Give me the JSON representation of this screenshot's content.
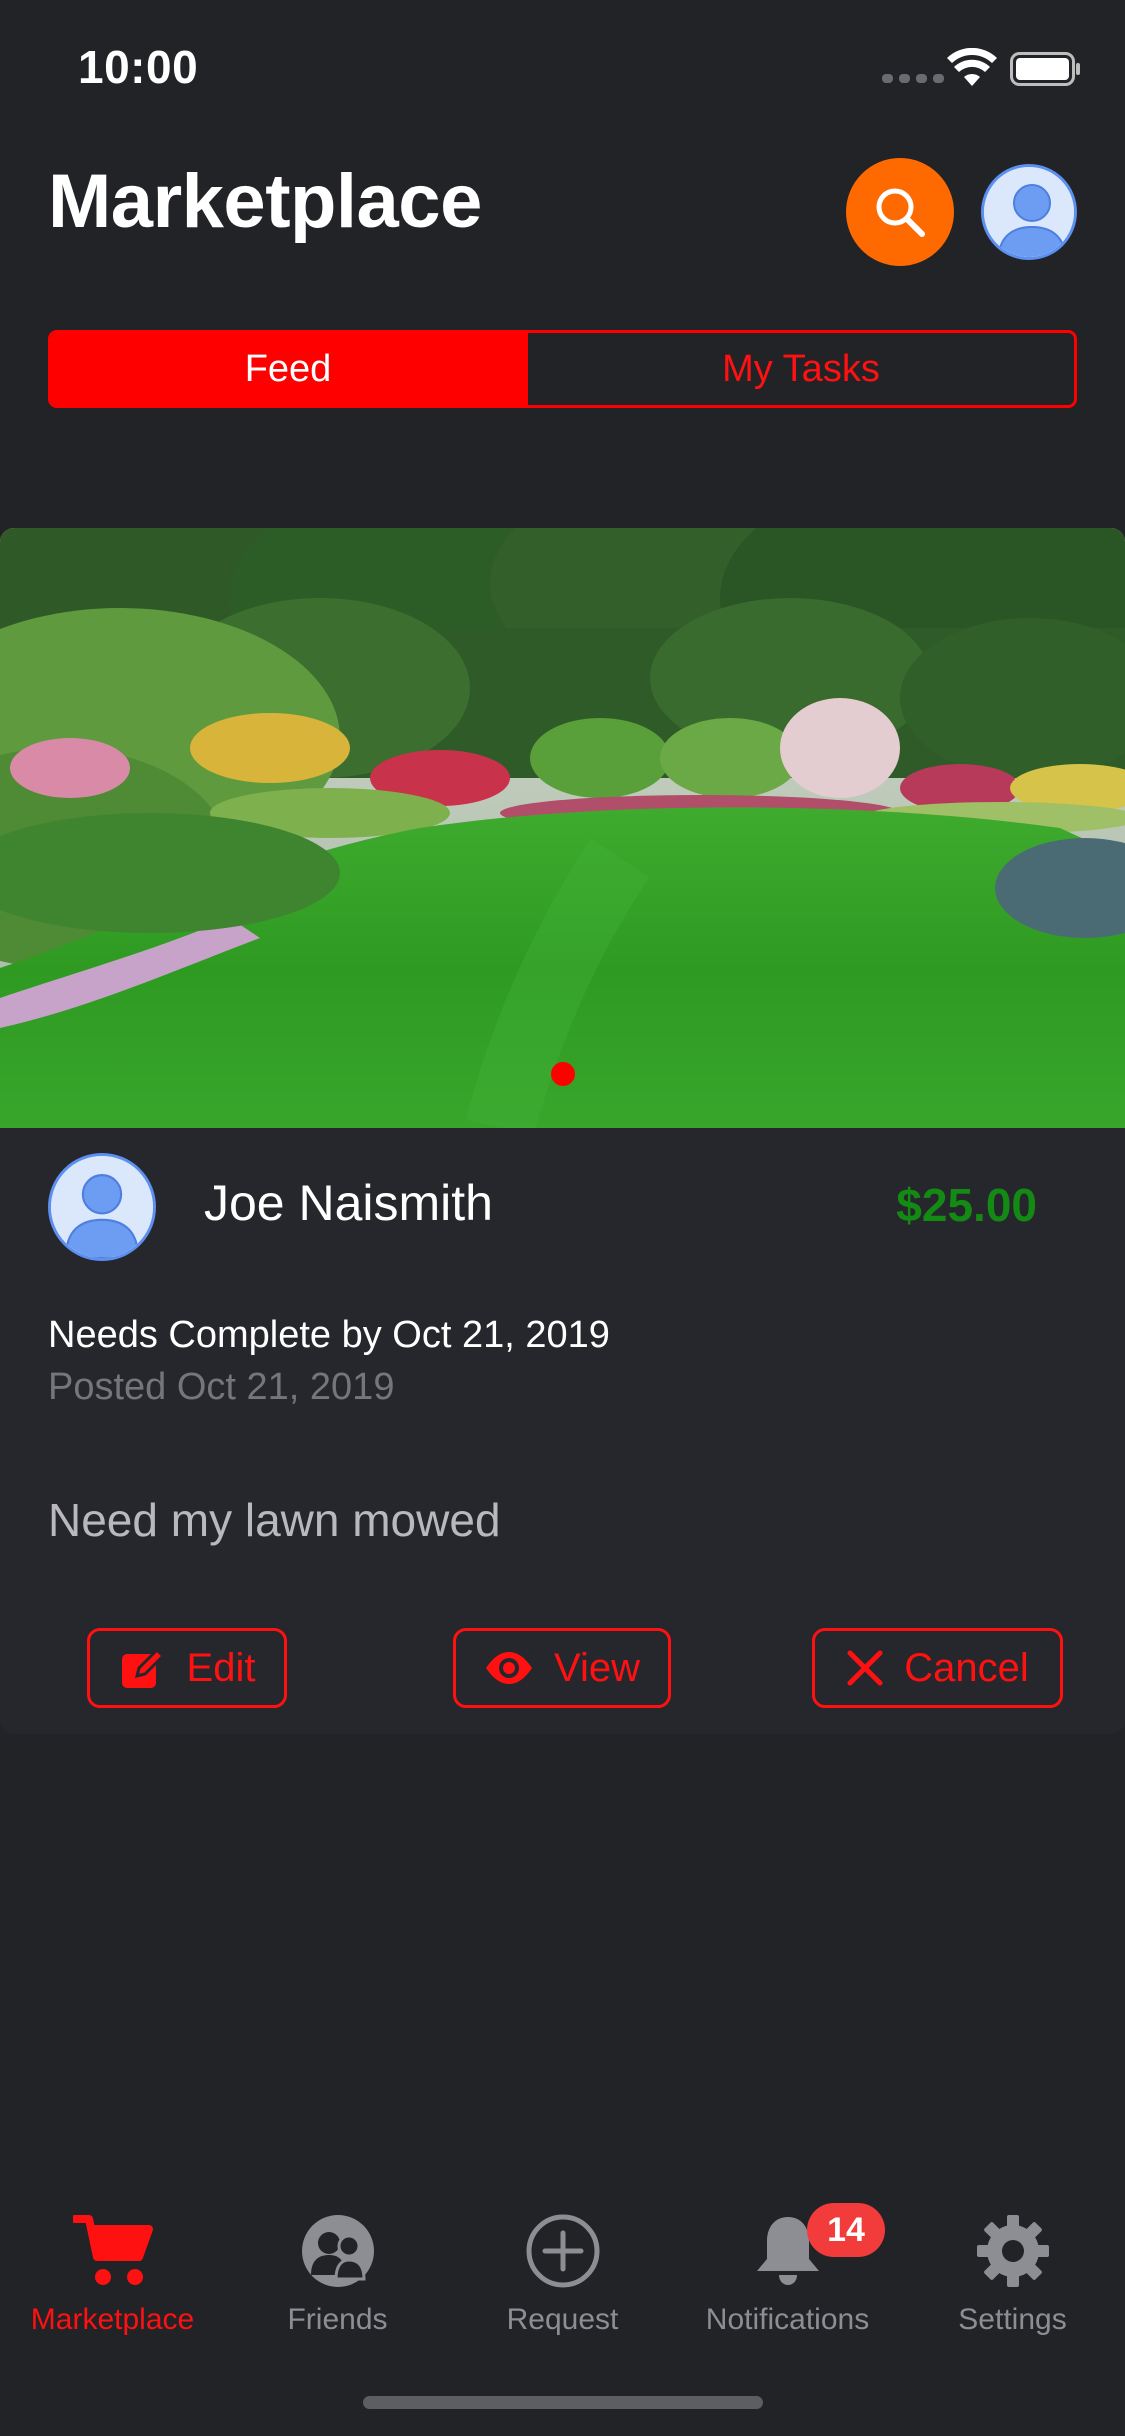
{
  "status_bar": {
    "time": "10:00"
  },
  "header": {
    "title": "Marketplace",
    "search_icon": "search-icon",
    "avatar_icon": "person-icon"
  },
  "segmented_control": {
    "selected": "Feed",
    "feed_label": "Feed",
    "my_tasks_label": "My Tasks"
  },
  "task_card": {
    "image": "lawn-garden-photo",
    "carousel": {
      "current_page": 1,
      "total_pages": 1
    },
    "poster_name": "Joe Naismith",
    "price": "$25.00",
    "deadline": "Needs Complete by Oct 21, 2019",
    "posted": "Posted Oct 21, 2019",
    "description": "Need my lawn mowed",
    "actions": {
      "edit_label": "Edit",
      "view_label": "View",
      "cancel_label": "Cancel"
    }
  },
  "tab_bar": {
    "items": [
      {
        "label": "Marketplace",
        "icon": "cart-icon",
        "active": true
      },
      {
        "label": "Friends",
        "icon": "friends-icon",
        "active": false
      },
      {
        "label": "Request",
        "icon": "plus-circle-icon",
        "active": false
      },
      {
        "label": "Notifications",
        "icon": "bell-icon",
        "active": false,
        "badge": "14"
      },
      {
        "label": "Settings",
        "icon": "gear-icon",
        "active": false
      }
    ]
  },
  "colors": {
    "background": "#222327",
    "card_background": "#26272c",
    "accent_red": "#ff0000",
    "search_orange": "#ff6a00",
    "price_green": "#138a13",
    "muted_text": "#75767b",
    "badge_red": "#f23c3c"
  }
}
